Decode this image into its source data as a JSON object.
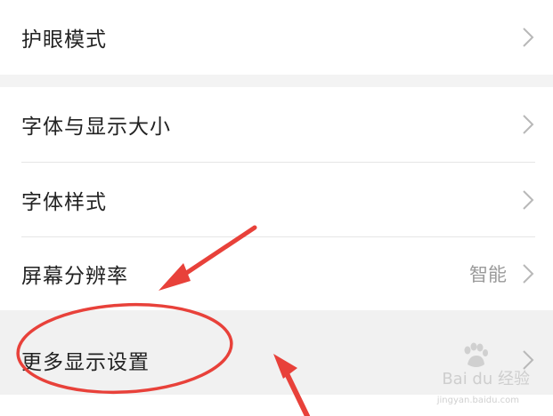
{
  "settings": {
    "items": [
      {
        "label": "护眼模式",
        "value": ""
      },
      {
        "label": "字体与显示大小",
        "value": ""
      },
      {
        "label": "字体样式",
        "value": ""
      },
      {
        "label": "屏幕分辨率",
        "value": "智能"
      },
      {
        "label": "更多显示设置",
        "value": ""
      }
    ]
  },
  "watermark": {
    "brand": "Bai du 经验",
    "url": "jingyan.baidu.com"
  },
  "colors": {
    "annotation": "#e8413a",
    "highlight_row": "#f1f1f1",
    "chevron": "#b8b8b8"
  }
}
